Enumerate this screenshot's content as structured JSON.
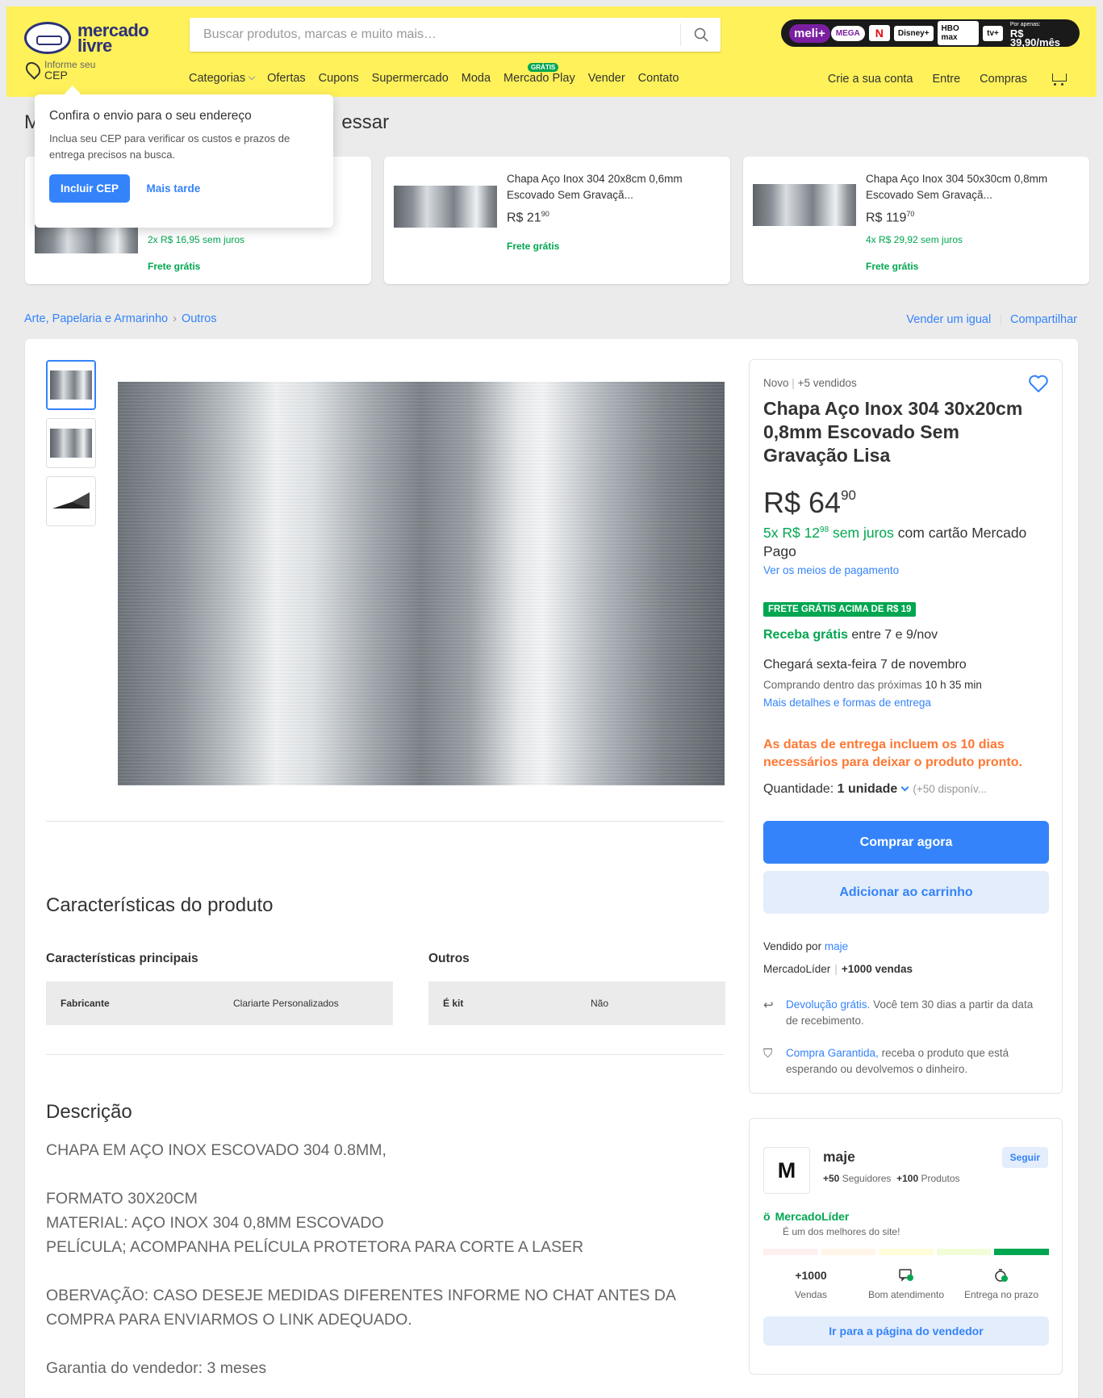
{
  "header": {
    "logo_line1": "mercado",
    "logo_line2": "livre",
    "search_placeholder": "Buscar produtos, marcas e muito mais…",
    "promo": {
      "brand": "meli+",
      "tier": "MEGA",
      "chips": [
        "N",
        "Disney+",
        "HBO max",
        "tv+"
      ],
      "price_label": "Por apenas:",
      "price": "R$ 39,90/mês"
    },
    "cep_small": "Informe seu",
    "cep_big": "CEP",
    "nav": [
      "Categorias",
      "Ofertas",
      "Cupons",
      "Supermercado",
      "Moda",
      "Mercado Play",
      "Vender",
      "Contato"
    ],
    "play_badge": "GRÁTIS",
    "nav_right": [
      "Crie a sua conta",
      "Entre",
      "Compras"
    ]
  },
  "popup": {
    "title": "Confira o envio para o seu endereço",
    "text": "Inclua seu CEP para verificar os custos e prazos de entrega precisos na busca.",
    "primary": "Incluir CEP",
    "secondary": "Mais tarde"
  },
  "might_title": "M                                                        essar",
  "recommendations": [
    {
      "title": "",
      "price": "",
      "cents": "",
      "installments": "2x R$ 16,95 sem juros",
      "shipping": "Frete grátis"
    },
    {
      "title": "Chapa Aço Inox 304 20x8cm 0,6mm Escovado Sem Gravaçã...",
      "price": "R$ 21",
      "cents": "90",
      "installments": "",
      "shipping": "Frete grátis"
    },
    {
      "title": "Chapa Aço Inox 304 50x30cm 0,8mm Escovado Sem Gravaçã...",
      "price": "R$ 119",
      "cents": "70",
      "installments": "4x R$ 29,92 sem juros",
      "shipping": "Frete grátis"
    }
  ],
  "breadcrumb": [
    "Arte, Papelaria e Armarinho",
    "Outros"
  ],
  "share": [
    "Vender um igual",
    "Compartilhar"
  ],
  "product": {
    "condition": "Novo",
    "sold": "+5 vendidos",
    "title": "Chapa Aço Inox 304 30x20cm 0,8mm Escovado Sem Gravação Lisa",
    "price_int": "R$ 64",
    "price_cents": "90",
    "installments_green": "5x R$ 12",
    "installments_cents": "98",
    "installments_green2": "sem juros",
    "installments_rest": "com cartão Mercado Pago",
    "payment_link": "Ver os meios de pagamento",
    "free_badge": "FRETE GRÁTIS ACIMA DE R$ 19",
    "receive_green": "Receba grátis",
    "receive_rest": "entre 7 e 9/nov",
    "arrives": "Chegará sexta-feira 7 de novembro",
    "buying_within": "Comprando dentro das próximas",
    "buying_time": "10 h 35 min",
    "delivery_link": "Mais detalhes e formas de entrega",
    "warning": "As datas de entrega incluem os 10 dias necessários para deixar o produto pronto.",
    "qty_label": "Quantidade:",
    "qty_value": "1 unidade",
    "qty_available": "(+50 disponív...",
    "buy_now": "Comprar agora",
    "add_cart": "Adicionar ao carrinho",
    "sold_by_label": "Vendido por",
    "sold_by": "maje",
    "leader": "MercadoLíder",
    "leader_sales": "+1000 vendas",
    "return_link": "Devolução grátis.",
    "return_text": "Você tem 30 dias a partir da data de recebimento.",
    "guarantee_link": "Compra Garantida,",
    "guarantee_text": "receba o produto que está esperando ou devolvemos o dinheiro."
  },
  "specs": {
    "title": "Características do produto",
    "main_title": "Características principais",
    "other_title": "Outros",
    "main_key": "Fabricante",
    "main_val": "Clariarte Personalizados",
    "other_key": "É kit",
    "other_val": "Não"
  },
  "description": {
    "title": "Descrição",
    "p1": "CHAPA EM AÇO INOX ESCOVADO 304 0.8MM,",
    "p2a": "FORMATO 30X20CM",
    "p2b": "MATERIAL: AÇO INOX 304 0,8MM ESCOVADO",
    "p2c": "PELÍCULA; ACOMPANHA PELÍCULA PROTETORA PARA CORTE A LASER",
    "p3": "OBERVAÇÃO: CASO DESEJE MEDIDAS DIFERENTES INFORME NO CHAT ANTES DA COMPRA PARA ENVIARMOS O LINK ADEQUADO.",
    "p4": "Garantia do vendedor: 3 meses"
  },
  "seller": {
    "initial": "M",
    "name": "maje",
    "followers": "+50",
    "followers_label": "Seguidores",
    "products": "+100",
    "products_label": "Produtos",
    "follow": "Seguir",
    "leader": "MercadoLíder",
    "leader_sub": "É um dos melhores do site!",
    "sales": "+1000",
    "sales_label": "Vendas",
    "service_label": "Bom atendimento",
    "ontime_label": "Entrega no prazo",
    "button": "Ir para a página do vendedor"
  },
  "colors": {
    "header_yellow": "#fff159",
    "primary_blue": "#3483fa",
    "green": "#00a650",
    "orange": "#ff7733"
  }
}
